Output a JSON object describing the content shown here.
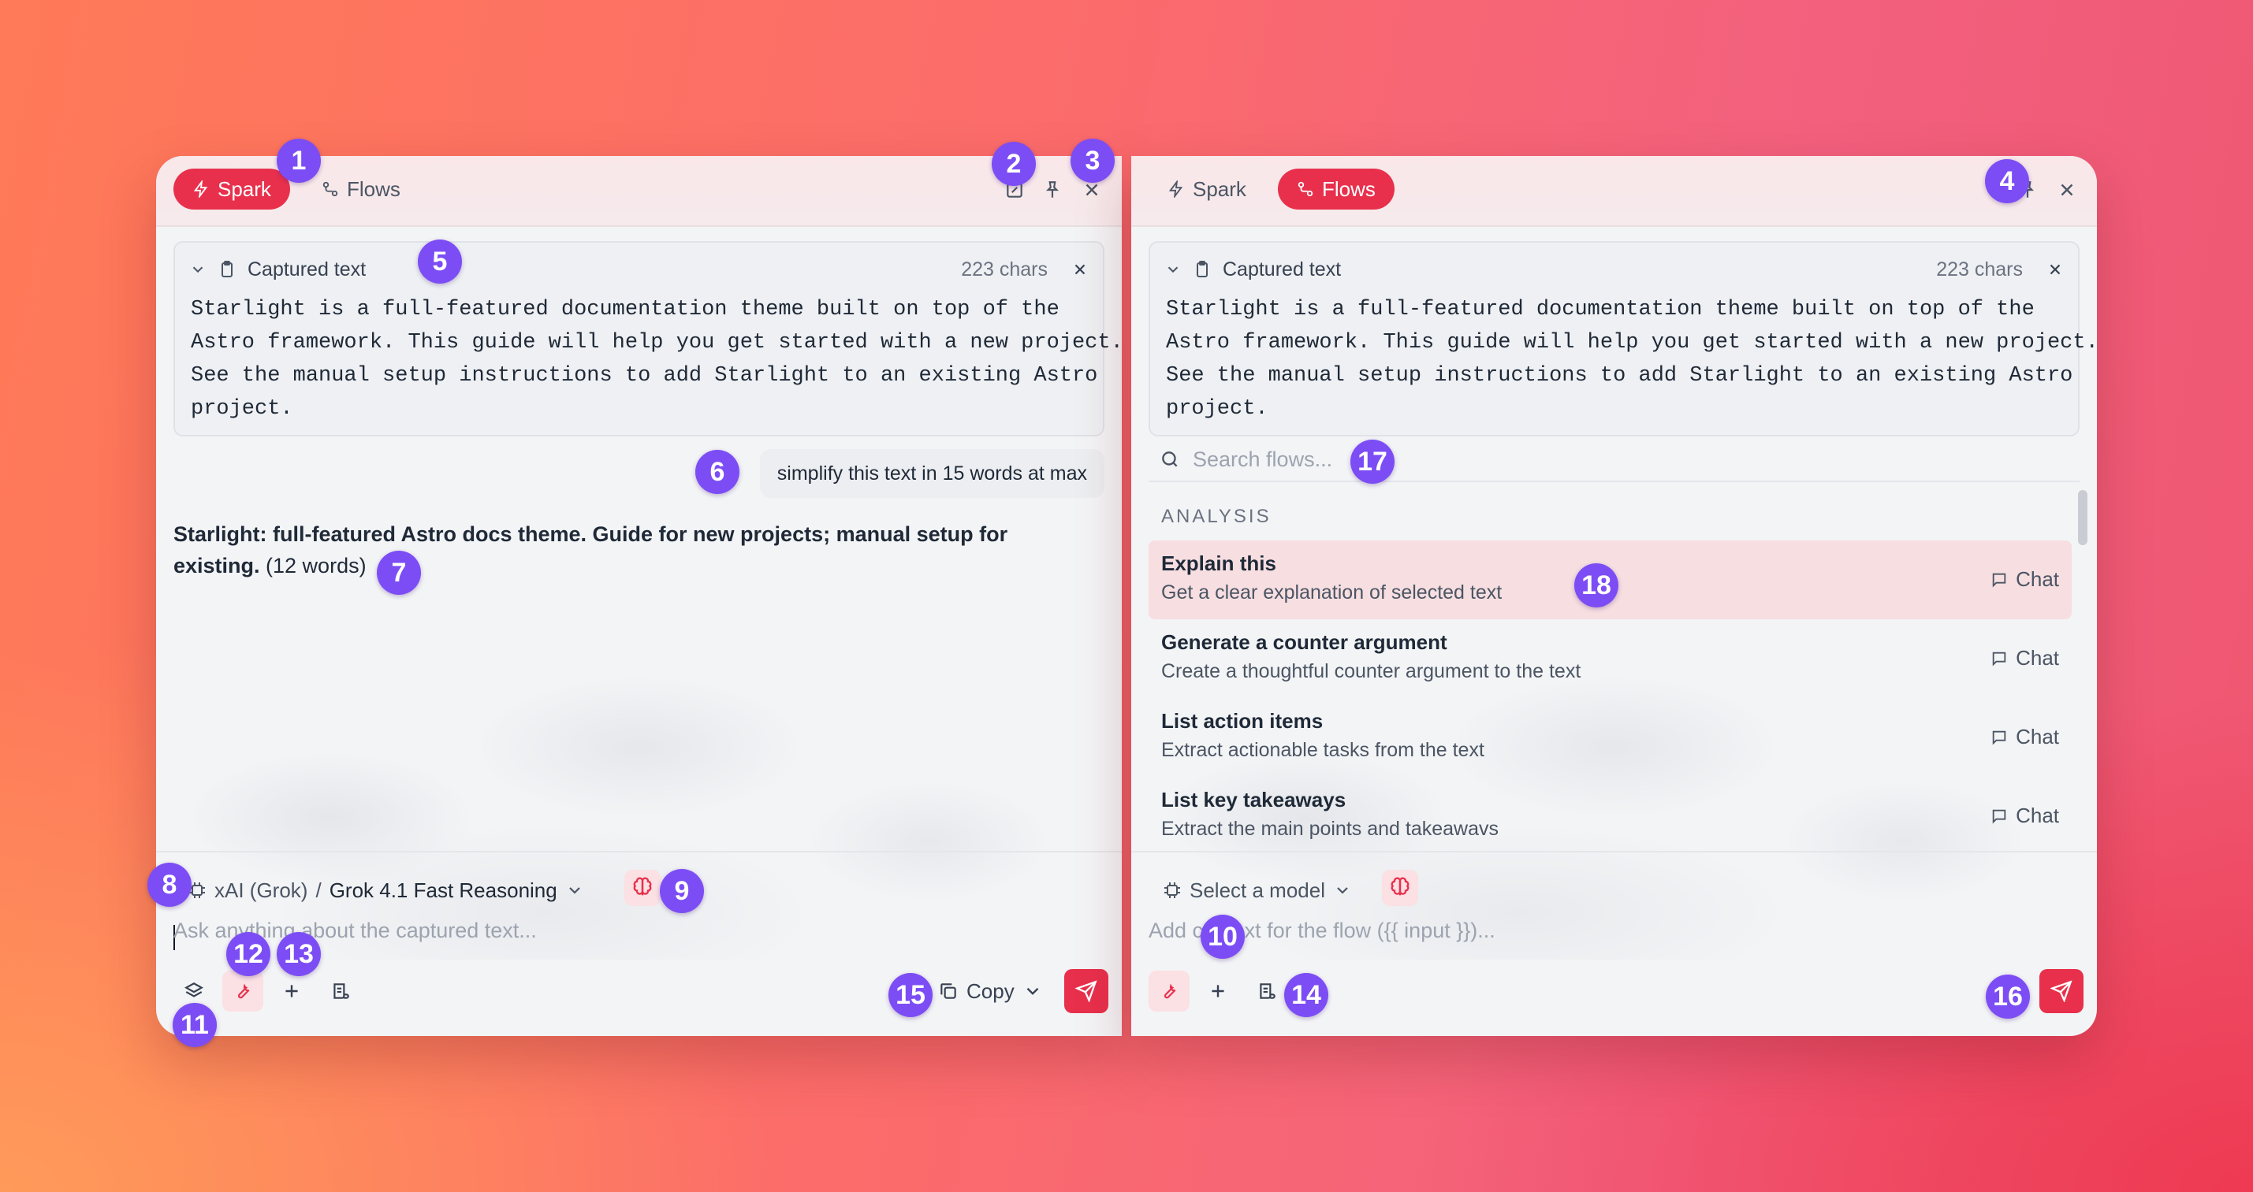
{
  "left_panel": {
    "tabs": [
      {
        "label": "Spark",
        "icon": "bolt-icon",
        "active": true
      },
      {
        "label": "Flows",
        "icon": "flow-icon",
        "active": false
      }
    ],
    "header_icons": [
      "new-chat-icon",
      "pin-icon",
      "close-icon"
    ],
    "captured": {
      "title": "Captured text",
      "count": "223 chars",
      "text": "Starlight is a full-featured documentation theme built on top of the\nAstro framework. This guide will help you get started with a new project.\nSee the manual setup instructions to add Starlight to an existing Astro\nproject."
    },
    "user_message": "simplify this text in 15 words at max",
    "answer_bold": "Starlight: full-featured Astro docs theme. Guide for new projects; manual setup for existing.",
    "answer_rest": " (12 words)",
    "model": {
      "provider": "xAI (Grok)",
      "separator": "/",
      "name": "Grok 4.1 Fast Reasoning"
    },
    "prompt_placeholder": "Ask anything about the captured text...",
    "copy_label": "Copy"
  },
  "right_panel": {
    "tabs": [
      {
        "label": "Spark",
        "icon": "bolt-icon",
        "active": false
      },
      {
        "label": "Flows",
        "icon": "flow-icon",
        "active": true
      }
    ],
    "captured": {
      "title": "Captured text",
      "count": "223 chars",
      "text": "Starlight is a full-featured documentation theme built on top of the\nAstro framework. This guide will help you get started with a new project.\nSee the manual setup instructions to add Starlight to an existing Astro\nproject."
    },
    "search_placeholder": "Search flows...",
    "section_label": "ANALYSIS",
    "flows": [
      {
        "title": "Explain this",
        "desc": "Get a clear explanation of selected text",
        "action": "Chat"
      },
      {
        "title": "Generate a counter argument",
        "desc": "Create a thoughtful counter argument to the text",
        "action": "Chat"
      },
      {
        "title": "List action items",
        "desc": "Extract actionable tasks from the text",
        "action": "Chat"
      },
      {
        "title": "List key takeaways",
        "desc": "Extract the main points and takeawavs",
        "action": "Chat"
      }
    ],
    "model_placeholder": "Select a model",
    "prompt_placeholder": "Add context for the flow ({{ input }})..."
  },
  "badges": [
    "1",
    "2",
    "3",
    "4",
    "5",
    "6",
    "7",
    "8",
    "9",
    "10",
    "11",
    "12",
    "13",
    "14",
    "15",
    "16",
    "17",
    "18"
  ],
  "colors": {
    "accent": "#e8304c",
    "badge": "#7c4df5"
  }
}
